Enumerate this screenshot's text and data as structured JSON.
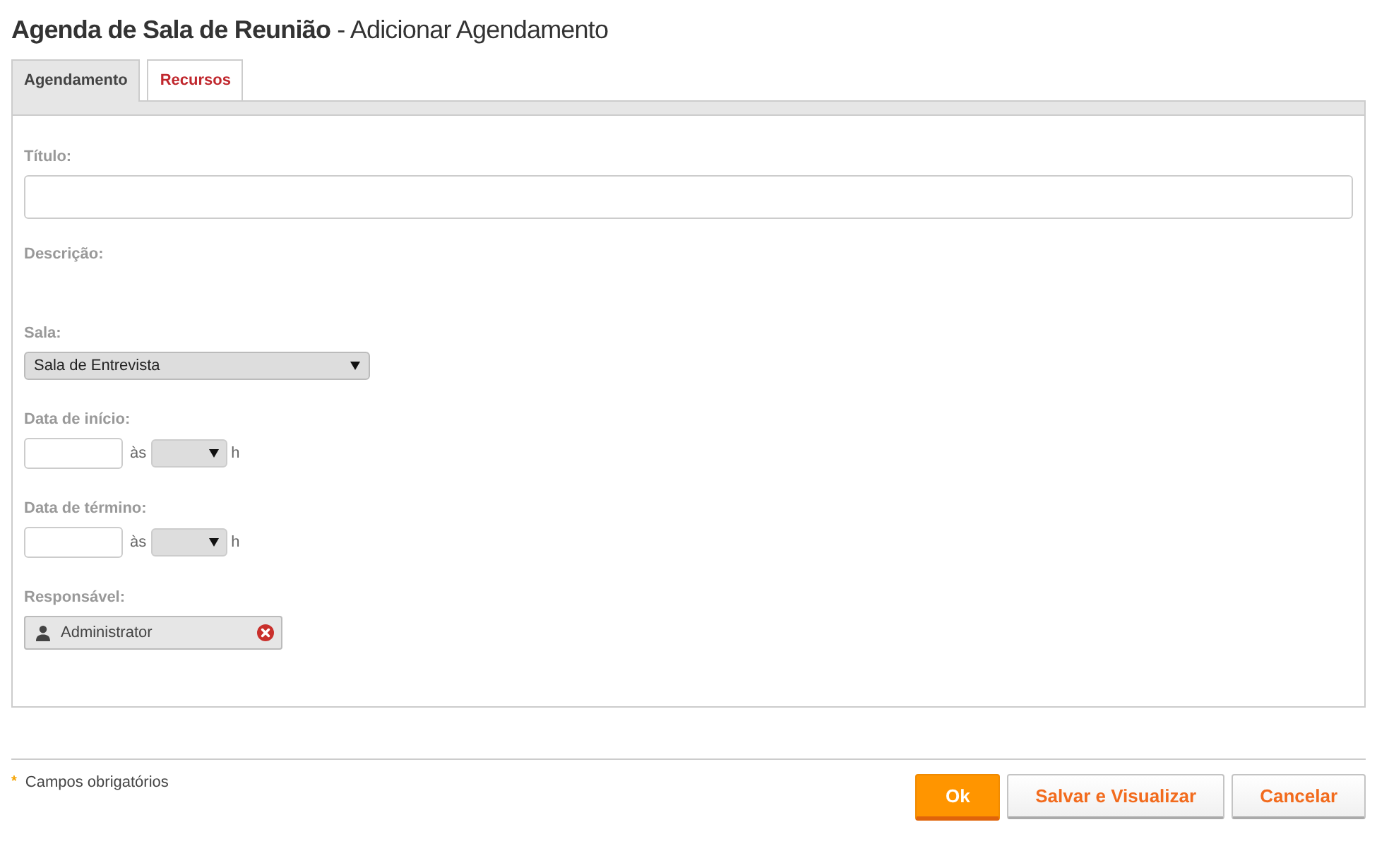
{
  "page_title": "**Agenda de Sala de Reunião** - Adicionar Agendamento",
  "tabs": [
    {
      "label": "Agendamento",
      "selected": true
    },
    {
      "label": "Recursos",
      "selected": false
    }
  ],
  "form": {
    "fields": [
      {
        "kind": "text",
        "label": "Título:"
      },
      {
        "kind": "label_only",
        "label": "Descrição:"
      },
      {
        "kind": "select",
        "label": "Sala:",
        "value": "Sala de Entrevista"
      },
      {
        "kind": "datetime",
        "label": "Data de início:",
        "at": "às",
        "unit": "h"
      },
      {
        "kind": "datetime",
        "label": "Data de término:",
        "at": "às",
        "unit": "h"
      },
      {
        "kind": "user",
        "label": "Responsável:",
        "value": "Administrator"
      }
    ]
  },
  "required_note": {
    "mark": "*",
    "text": "Campos obrigatórios"
  },
  "buttons": [
    {
      "label": "Ok",
      "kind": "primary"
    },
    {
      "label": "Salvar e Visualizar",
      "kind": "secondary"
    },
    {
      "label": "Cancelar",
      "kind": "secondary"
    }
  ]
}
